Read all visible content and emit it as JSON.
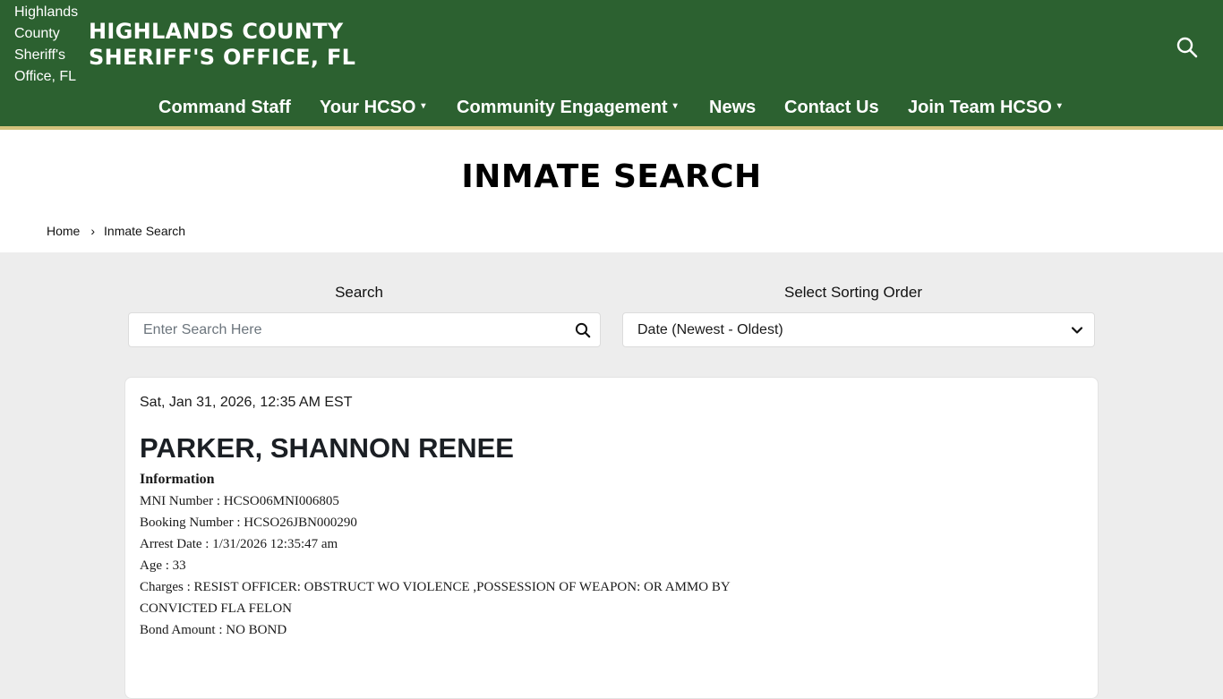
{
  "header": {
    "logo_alt": "Highlands County Sheriff's Office, FL",
    "site_title_line1": "HIGHLANDS COUNTY",
    "site_title_line2": "SHERIFF'S OFFICE, FL",
    "search_icon": "search-icon"
  },
  "nav": {
    "items": [
      {
        "label": "Command Staff"
      },
      {
        "label": "Your HCSO",
        "dropdown": true
      },
      {
        "label": "Community Engagement",
        "dropdown": true
      },
      {
        "label": "News"
      },
      {
        "label": "Contact Us"
      },
      {
        "label": "Join Team HCSO",
        "dropdown": true
      }
    ],
    "caret": "▾"
  },
  "page": {
    "title": "INMATE SEARCH",
    "breadcrumb": {
      "home": "Home",
      "separator": "›",
      "current": "Inmate Search"
    }
  },
  "search": {
    "label": "Search",
    "placeholder": "Enter Search Here",
    "icon": "search-icon"
  },
  "sort": {
    "label": "Select Sorting Order",
    "selected": "Date (Newest - Oldest)",
    "icon": "chevron-down-icon"
  },
  "record": {
    "timestamp": "Sat, Jan 31, 2026, 12:35 AM EST",
    "name": "PARKER, SHANNON RENEE",
    "info_heading": "Information",
    "mni": "MNI Number : HCSO06MNI006805",
    "booking": "Booking Number : HCSO26JBN000290",
    "arrest_date": "Arrest Date : 1/31/2026 12:35:47 am",
    "age": "Age : 33",
    "charges_line1": "Charges : RESIST OFFICER: OBSTRUCT WO VIOLENCE ,POSSESSION OF WEAPON: OR AMMO BY",
    "charges_line2": "CONVICTED FLA FELON",
    "bond": "Bond Amount : NO BOND"
  },
  "colors": {
    "header_green": "#2c6130",
    "accent_gold": "#d3c27c",
    "page_bg": "#ededed"
  }
}
